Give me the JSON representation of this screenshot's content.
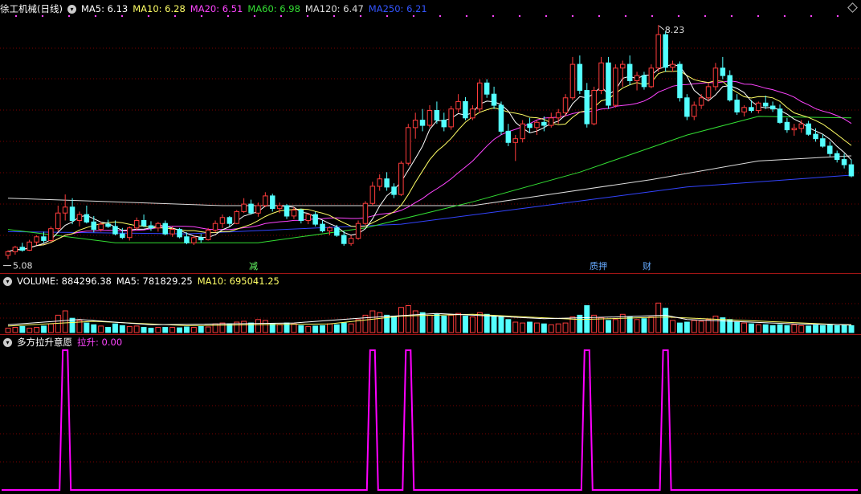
{
  "header": {
    "stock_title": "徐工机械(日线)",
    "ma_items": [
      {
        "label": "MA5: 6.13",
        "color": "#ffffff"
      },
      {
        "label": "MA10: 6.28",
        "color": "#ffff66"
      },
      {
        "label": "MA20: 6.51",
        "color": "#ff44ff"
      },
      {
        "label": "MA60: 6.98",
        "color": "#33dd33"
      },
      {
        "label": "MA120: 6.47",
        "color": "#dddddd"
      },
      {
        "label": "MA250: 6.21",
        "color": "#3344ff"
      }
    ]
  },
  "volume_header": {
    "title": "VOLUME: 884296.38",
    "ma5": "MA5: 781829.25",
    "ma10": "MA10: 695041.25"
  },
  "indicator_header": {
    "title": "多方拉升意愿",
    "value": "拉升: 0.00"
  },
  "annotations": {
    "high_label": "8.23",
    "low_label": "5.08",
    "markers": [
      {
        "text": "减",
        "color": "#66ff66"
      },
      {
        "text": "质押",
        "color": "#66aaff"
      },
      {
        "text": "财",
        "color": "#66aaff"
      }
    ]
  },
  "colors": {
    "up": "#ff3c3c",
    "down": "#54ffff",
    "grid": "#7a0000",
    "divider": "#a01515",
    "indicator": "#ff00ff",
    "ma5": "#ffffff",
    "ma10": "#ffff66",
    "ma20": "#ff44ff",
    "ma60": "#33dd33",
    "ma120": "#dddddd",
    "ma250": "#3344ff"
  },
  "chart_data": [
    {
      "type": "candlestick",
      "title": "徐工机械(日线)",
      "ylim": [
        5.0,
        8.35
      ],
      "count": 119,
      "ohlc": [
        [
          5.13,
          5.2,
          5.08,
          5.18
        ],
        [
          5.18,
          5.26,
          5.14,
          5.24
        ],
        [
          5.24,
          5.3,
          5.18,
          5.2
        ],
        [
          5.2,
          5.34,
          5.19,
          5.31
        ],
        [
          5.31,
          5.4,
          5.27,
          5.38
        ],
        [
          5.38,
          5.45,
          5.3,
          5.33
        ],
        [
          5.33,
          5.52,
          5.31,
          5.49
        ],
        [
          5.49,
          5.8,
          5.45,
          5.7
        ],
        [
          5.7,
          5.95,
          5.6,
          5.78
        ],
        [
          5.78,
          5.9,
          5.55,
          5.6
        ],
        [
          5.6,
          5.72,
          5.52,
          5.68
        ],
        [
          5.68,
          5.8,
          5.56,
          5.58
        ],
        [
          5.58,
          5.66,
          5.44,
          5.48
        ],
        [
          5.48,
          5.58,
          5.45,
          5.55
        ],
        [
          5.55,
          5.61,
          5.5,
          5.52
        ],
        [
          5.52,
          5.6,
          5.4,
          5.42
        ],
        [
          5.42,
          5.5,
          5.35,
          5.37
        ],
        [
          5.37,
          5.52,
          5.33,
          5.5
        ],
        [
          5.5,
          5.64,
          5.47,
          5.6
        ],
        [
          5.6,
          5.68,
          5.51,
          5.53
        ],
        [
          5.53,
          5.59,
          5.46,
          5.5
        ],
        [
          5.5,
          5.58,
          5.45,
          5.56
        ],
        [
          5.56,
          5.6,
          5.4,
          5.42
        ],
        [
          5.42,
          5.52,
          5.38,
          5.48
        ],
        [
          5.48,
          5.5,
          5.36,
          5.38
        ],
        [
          5.38,
          5.44,
          5.28,
          5.3
        ],
        [
          5.3,
          5.4,
          5.27,
          5.37
        ],
        [
          5.37,
          5.42,
          5.3,
          5.34
        ],
        [
          5.34,
          5.5,
          5.33,
          5.47
        ],
        [
          5.47,
          5.6,
          5.44,
          5.56
        ],
        [
          5.56,
          5.68,
          5.5,
          5.64
        ],
        [
          5.64,
          5.66,
          5.52,
          5.56
        ],
        [
          5.56,
          5.74,
          5.55,
          5.72
        ],
        [
          5.72,
          5.9,
          5.7,
          5.82
        ],
        [
          5.82,
          5.88,
          5.68,
          5.7
        ],
        [
          5.7,
          5.84,
          5.65,
          5.8
        ],
        [
          5.8,
          5.98,
          5.78,
          5.93
        ],
        [
          5.93,
          5.96,
          5.72,
          5.76
        ],
        [
          5.76,
          5.84,
          5.7,
          5.8
        ],
        [
          5.8,
          5.82,
          5.62,
          5.66
        ],
        [
          5.66,
          5.78,
          5.62,
          5.74
        ],
        [
          5.74,
          5.76,
          5.56,
          5.6
        ],
        [
          5.6,
          5.7,
          5.55,
          5.68
        ],
        [
          5.68,
          5.72,
          5.52,
          5.55
        ],
        [
          5.55,
          5.6,
          5.44,
          5.46
        ],
        [
          5.46,
          5.52,
          5.4,
          5.5
        ],
        [
          5.5,
          5.54,
          5.38,
          5.4
        ],
        [
          5.4,
          5.46,
          5.26,
          5.29
        ],
        [
          5.29,
          5.4,
          5.26,
          5.36
        ],
        [
          5.36,
          5.6,
          5.34,
          5.56
        ],
        [
          5.56,
          5.86,
          5.54,
          5.83
        ],
        [
          5.83,
          6.12,
          5.8,
          6.06
        ],
        [
          6.06,
          6.22,
          6.0,
          6.16
        ],
        [
          6.16,
          6.25,
          6.0,
          6.05
        ],
        [
          6.05,
          6.1,
          5.9,
          5.95
        ],
        [
          5.95,
          6.4,
          5.93,
          6.37
        ],
        [
          6.37,
          6.9,
          6.34,
          6.85
        ],
        [
          6.85,
          7.05,
          6.7,
          6.95
        ],
        [
          6.95,
          7.1,
          6.8,
          6.88
        ],
        [
          6.88,
          7.15,
          6.85,
          7.08
        ],
        [
          7.08,
          7.2,
          6.9,
          6.95
        ],
        [
          6.95,
          7.05,
          6.8,
          6.86
        ],
        [
          6.86,
          7.14,
          6.82,
          7.1
        ],
        [
          7.1,
          7.3,
          7.05,
          7.2
        ],
        [
          7.2,
          7.26,
          6.95,
          6.98
        ],
        [
          6.98,
          7.15,
          6.95,
          7.1
        ],
        [
          7.1,
          7.5,
          7.05,
          7.45
        ],
        [
          7.45,
          7.5,
          7.25,
          7.3
        ],
        [
          7.3,
          7.4,
          7.1,
          7.15
        ],
        [
          7.15,
          7.2,
          6.75,
          6.8
        ],
        [
          6.8,
          6.9,
          6.6,
          6.65
        ],
        [
          6.65,
          6.75,
          6.4,
          6.7
        ],
        [
          6.7,
          6.95,
          6.65,
          6.9
        ],
        [
          6.9,
          6.98,
          6.78,
          6.85
        ],
        [
          6.85,
          6.95,
          6.75,
          6.92
        ],
        [
          6.92,
          7.0,
          6.8,
          6.88
        ],
        [
          6.88,
          7.05,
          6.85,
          6.98
        ],
        [
          6.98,
          7.1,
          6.9,
          7.05
        ],
        [
          7.05,
          7.3,
          7.0,
          7.25
        ],
        [
          7.25,
          7.8,
          7.22,
          7.7
        ],
        [
          7.7,
          7.82,
          7.3,
          7.35
        ],
        [
          7.35,
          7.45,
          6.85,
          6.9
        ],
        [
          6.9,
          7.4,
          6.88,
          7.35
        ],
        [
          7.35,
          7.8,
          7.3,
          7.72
        ],
        [
          7.72,
          7.8,
          7.1,
          7.15
        ],
        [
          7.15,
          7.7,
          7.12,
          7.65
        ],
        [
          7.65,
          7.75,
          7.4,
          7.7
        ],
        [
          7.7,
          7.82,
          7.42,
          7.48
        ],
        [
          7.48,
          7.6,
          7.35,
          7.55
        ],
        [
          7.55,
          7.6,
          7.36,
          7.4
        ],
        [
          7.4,
          7.7,
          7.38,
          7.65
        ],
        [
          7.65,
          8.23,
          7.6,
          8.1
        ],
        [
          8.1,
          8.15,
          7.6,
          7.66
        ],
        [
          7.66,
          7.75,
          7.6,
          7.7
        ],
        [
          7.7,
          7.74,
          7.2,
          7.25
        ],
        [
          7.25,
          7.3,
          6.95,
          7.0
        ],
        [
          7.0,
          7.2,
          6.95,
          7.15
        ],
        [
          7.15,
          7.3,
          7.1,
          7.25
        ],
        [
          7.25,
          7.45,
          7.2,
          7.4
        ],
        [
          7.4,
          7.72,
          7.35,
          7.65
        ],
        [
          7.65,
          7.8,
          7.5,
          7.55
        ],
        [
          7.55,
          7.62,
          7.2,
          7.22
        ],
        [
          7.22,
          7.3,
          7.02,
          7.06
        ],
        [
          7.06,
          7.15,
          7.0,
          7.12
        ],
        [
          7.12,
          7.22,
          7.05,
          7.08
        ],
        [
          7.08,
          7.2,
          7.04,
          7.18
        ],
        [
          7.18,
          7.28,
          7.1,
          7.14
        ],
        [
          7.14,
          7.2,
          7.06,
          7.1
        ],
        [
          7.1,
          7.16,
          6.9,
          6.92
        ],
        [
          6.92,
          6.98,
          6.78,
          6.82
        ],
        [
          6.82,
          6.9,
          6.74,
          6.84
        ],
        [
          6.84,
          6.95,
          6.78,
          6.9
        ],
        [
          6.9,
          6.94,
          6.74,
          6.76
        ],
        [
          6.76,
          6.84,
          6.66,
          6.7
        ],
        [
          6.7,
          6.76,
          6.58,
          6.6
        ],
        [
          6.6,
          6.66,
          6.46,
          6.5
        ],
        [
          6.5,
          6.54,
          6.38,
          6.42
        ],
        [
          6.42,
          6.5,
          6.3,
          6.35
        ],
        [
          6.35,
          6.42,
          6.18,
          6.2
        ]
      ],
      "ma_series": [
        {
          "name": "MA250",
          "values": [
            [
              0,
              5.45
            ],
            [
              25,
              5.42
            ],
            [
              55,
              5.55
            ],
            [
              75,
              5.8
            ],
            [
              95,
              6.05
            ],
            [
              118,
              6.21
            ]
          ]
        },
        {
          "name": "MA120",
          "values": [
            [
              0,
              5.9
            ],
            [
              30,
              5.8
            ],
            [
              65,
              5.8
            ],
            [
              90,
              6.15
            ],
            [
              105,
              6.4
            ],
            [
              118,
              6.47
            ]
          ]
        },
        {
          "name": "MA60",
          "values": [
            [
              0,
              5.48
            ],
            [
              15,
              5.3
            ],
            [
              35,
              5.3
            ],
            [
              50,
              5.5
            ],
            [
              65,
              5.85
            ],
            [
              80,
              6.25
            ],
            [
              95,
              6.75
            ],
            [
              105,
              7.0
            ],
            [
              118,
              6.98
            ]
          ]
        }
      ]
    },
    {
      "type": "bar",
      "title": "VOLUME",
      "ylim": [
        0,
        1.0
      ],
      "values": [
        0.1,
        0.12,
        0.14,
        0.1,
        0.12,
        0.15,
        0.2,
        0.4,
        0.5,
        0.33,
        0.28,
        0.22,
        0.18,
        0.15,
        0.12,
        0.2,
        0.16,
        0.14,
        0.15,
        0.12,
        0.1,
        0.12,
        0.12,
        0.12,
        0.11,
        0.13,
        0.12,
        0.14,
        0.13,
        0.2,
        0.22,
        0.2,
        0.24,
        0.26,
        0.22,
        0.3,
        0.28,
        0.2,
        0.18,
        0.22,
        0.2,
        0.16,
        0.14,
        0.15,
        0.16,
        0.2,
        0.18,
        0.22,
        0.2,
        0.3,
        0.4,
        0.5,
        0.46,
        0.4,
        0.38,
        0.58,
        0.62,
        0.5,
        0.46,
        0.4,
        0.42,
        0.38,
        0.4,
        0.44,
        0.38,
        0.36,
        0.46,
        0.42,
        0.38,
        0.36,
        0.3,
        0.24,
        0.22,
        0.24,
        0.22,
        0.2,
        0.18,
        0.2,
        0.22,
        0.36,
        0.4,
        0.62,
        0.4,
        0.34,
        0.28,
        0.3,
        0.42,
        0.36,
        0.3,
        0.32,
        0.36,
        0.68,
        0.56,
        0.28,
        0.22,
        0.24,
        0.28,
        0.26,
        0.3,
        0.38,
        0.34,
        0.3,
        0.24,
        0.22,
        0.2,
        0.18,
        0.18,
        0.16,
        0.18,
        0.16,
        0.18,
        0.16,
        0.15,
        0.17,
        0.16,
        0.18,
        0.16,
        0.17,
        0.16
      ],
      "ma5": [
        [
          0,
          0.18
        ],
        [
          10,
          0.3
        ],
        [
          20,
          0.18
        ],
        [
          40,
          0.22
        ],
        [
          50,
          0.34
        ],
        [
          60,
          0.44
        ],
        [
          75,
          0.32
        ],
        [
          85,
          0.36
        ],
        [
          92,
          0.4
        ],
        [
          95,
          0.3
        ],
        [
          110,
          0.2
        ],
        [
          118,
          0.18
        ]
      ],
      "ma10": [
        [
          0,
          0.15
        ],
        [
          12,
          0.26
        ],
        [
          25,
          0.16
        ],
        [
          45,
          0.2
        ],
        [
          55,
          0.38
        ],
        [
          65,
          0.42
        ],
        [
          80,
          0.3
        ],
        [
          92,
          0.36
        ],
        [
          100,
          0.3
        ],
        [
          118,
          0.17
        ]
      ]
    },
    {
      "type": "line",
      "title": "多方拉升意愿",
      "ylim": [
        0,
        1
      ],
      "series": [
        {
          "name": "拉升",
          "color": "#ff00ff",
          "spikes": [
            8,
            51,
            56,
            81,
            92
          ],
          "baseline": 0
        }
      ]
    }
  ]
}
